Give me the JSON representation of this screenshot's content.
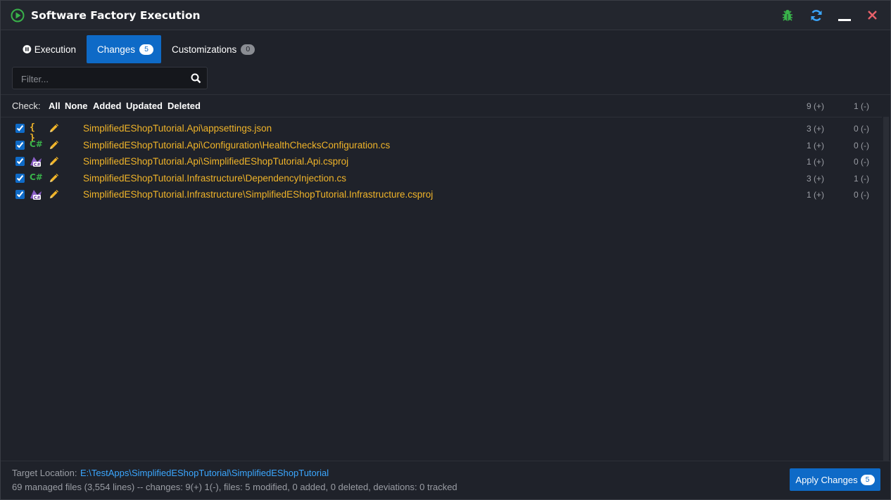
{
  "window": {
    "title": "Software Factory Execution"
  },
  "tabs": [
    {
      "label": "Execution",
      "icon": "pause-circle-icon",
      "active": false
    },
    {
      "label": "Changes",
      "badge": "5",
      "active": true
    },
    {
      "label": "Customizations",
      "badge": "0",
      "active": false
    }
  ],
  "filter": {
    "placeholder": "Filter..."
  },
  "check_bar": {
    "label": "Check:",
    "options": [
      "All",
      "None",
      "Added",
      "Updated",
      "Deleted"
    ],
    "total_added": "9 (+)",
    "total_deleted": "1 (-)"
  },
  "files": [
    {
      "checked": true,
      "type_icon": "json-icon",
      "type_text": "{ }",
      "path": "SimplifiedEShopTutorial.Api\\appsettings.json",
      "added": "3 (+)",
      "deleted": "0 (-)"
    },
    {
      "checked": true,
      "type_icon": "csharp-icon",
      "type_text": "C#",
      "path": "SimplifiedEShopTutorial.Api\\Configuration\\HealthChecksConfiguration.cs",
      "added": "1 (+)",
      "deleted": "0 (-)"
    },
    {
      "checked": true,
      "type_icon": "csproj-icon",
      "type_text": "",
      "path": "SimplifiedEShopTutorial.Api\\SimplifiedEShopTutorial.Api.csproj",
      "added": "1 (+)",
      "deleted": "0 (-)"
    },
    {
      "checked": true,
      "type_icon": "csharp-icon",
      "type_text": "C#",
      "path": "SimplifiedEShopTutorial.Infrastructure\\DependencyInjection.cs",
      "added": "3 (+)",
      "deleted": "1 (-)"
    },
    {
      "checked": true,
      "type_icon": "csproj-icon",
      "type_text": "",
      "path": "SimplifiedEShopTutorial.Infrastructure\\SimplifiedEShopTutorial.Infrastructure.csproj",
      "added": "1 (+)",
      "deleted": "0 (-)"
    }
  ],
  "footer": {
    "target_label": "Target Location:",
    "target_path": "E:\\TestApps\\SimplifiedEShopTutorial\\SimplifiedEShopTutorial",
    "stats": "69 managed files (3,554 lines) -- changes: 9(+) 1(-), files: 5 modified, 0 added, 0 deleted, deviations: 0 tracked",
    "apply_label": "Apply Changes",
    "apply_badge": "5"
  },
  "colors": {
    "accent": "#0e6ac7",
    "file_path": "#f0b429",
    "link": "#3ba7ff",
    "background": "#1f222a"
  }
}
